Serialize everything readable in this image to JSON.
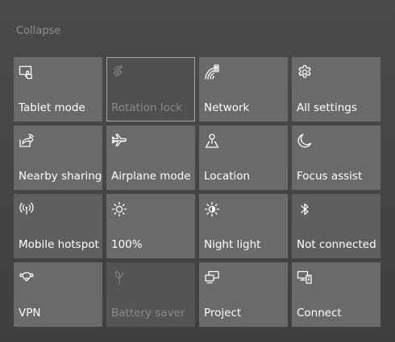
{
  "header": {
    "collapse_label": "Collapse"
  },
  "tiles": [
    {
      "label": "Tablet mode",
      "icon": "tablet-mode-icon",
      "state": "active"
    },
    {
      "label": "Rotation lock",
      "icon": "rotation-lock-icon",
      "state": "disabled-focused"
    },
    {
      "label": "Network",
      "icon": "network-icon",
      "state": "active"
    },
    {
      "label": "All settings",
      "icon": "gear-icon",
      "state": "active"
    },
    {
      "label": "Nearby sharing",
      "icon": "nearby-sharing-icon",
      "state": "active"
    },
    {
      "label": "Airplane mode",
      "icon": "airplane-icon",
      "state": "active"
    },
    {
      "label": "Location",
      "icon": "location-icon",
      "state": "active"
    },
    {
      "label": "Focus assist",
      "icon": "moon-icon",
      "state": "active"
    },
    {
      "label": "Mobile hotspot",
      "icon": "hotspot-icon",
      "state": "active"
    },
    {
      "label": "100%",
      "icon": "brightness-icon",
      "state": "active"
    },
    {
      "label": "Night light",
      "icon": "night-light-icon",
      "state": "active"
    },
    {
      "label": "Not connected",
      "icon": "bluetooth-icon",
      "state": "off"
    },
    {
      "label": "VPN",
      "icon": "vpn-icon",
      "state": "active"
    },
    {
      "label": "Battery saver",
      "icon": "battery-saver-icon",
      "state": "disabled"
    },
    {
      "label": "Project",
      "icon": "project-icon",
      "state": "active"
    },
    {
      "label": "Connect",
      "icon": "connect-icon",
      "state": "active"
    }
  ],
  "colors": {
    "background": "#464646",
    "tile": "#6a6a6a",
    "tile_off": "#5f5f5f",
    "tile_disabled": "#545454",
    "text": "#ffffff",
    "muted_text": "#8a8a8a"
  }
}
